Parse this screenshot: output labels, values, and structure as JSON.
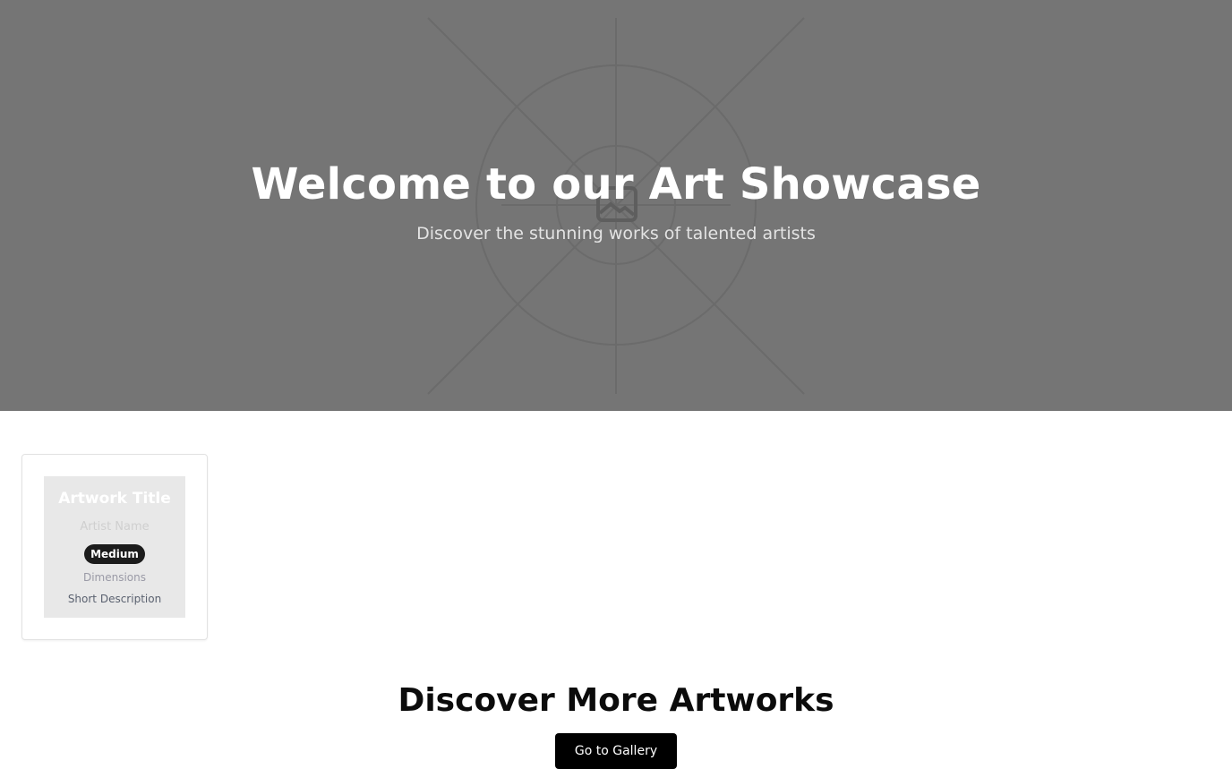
{
  "hero": {
    "title": "Welcome to our Art Showcase",
    "subtitle": "Discover the stunning works of talented artists",
    "background_color": "#757575",
    "placeholder_icon": "image-icon"
  },
  "artwork_card": {
    "title": "Artwork Title",
    "artist": "Artist Name",
    "medium": "Medium",
    "dimensions": "Dimensions",
    "description": "Short Description"
  },
  "discover": {
    "heading": "Discover More Artworks",
    "button_label": "Go to Gallery"
  }
}
